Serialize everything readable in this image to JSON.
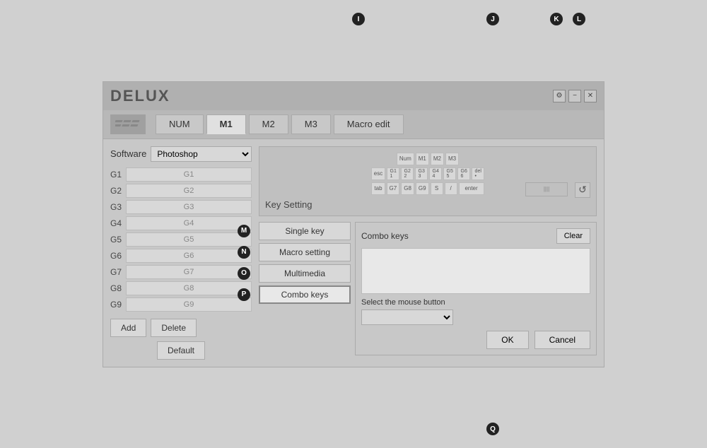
{
  "app": {
    "title": "DELUX",
    "window_controls": {
      "settings_label": "⚙",
      "minimize_label": "−",
      "close_label": "✕"
    }
  },
  "nav": {
    "icon_label": "///",
    "tabs": [
      {
        "id": "num",
        "label": "NUM",
        "active": false
      },
      {
        "id": "m1",
        "label": "M1",
        "active": true
      },
      {
        "id": "m2",
        "label": "M2",
        "active": false
      },
      {
        "id": "m3",
        "label": "M3",
        "active": false
      },
      {
        "id": "macro_edit",
        "label": "Macro edit",
        "active": false
      }
    ]
  },
  "left_panel": {
    "software_label": "Software",
    "software_value": "Photoshop",
    "g_keys": [
      {
        "label": "G1",
        "value": "G1"
      },
      {
        "label": "G2",
        "value": "G2"
      },
      {
        "label": "G3",
        "value": "G3"
      },
      {
        "label": "G4",
        "value": "G4"
      },
      {
        "label": "G5",
        "value": "G5"
      },
      {
        "label": "G6",
        "value": "G6"
      },
      {
        "label": "G7",
        "value": "G7"
      },
      {
        "label": "G8",
        "value": "G8"
      },
      {
        "label": "G9",
        "value": "G9"
      }
    ],
    "add_label": "Add",
    "delete_label": "Delete",
    "default_label": "Default"
  },
  "key_setting": {
    "label": "Key Setting",
    "reset_icon": "↺"
  },
  "options": {
    "single_key_label": "Single key",
    "macro_setting_label": "Macro setting",
    "multimedia_label": "Multimedia",
    "combo_keys_label": "Combo keys"
  },
  "combo_panel": {
    "title": "Combo keys",
    "clear_label": "Clear",
    "mouse_btn_label": "Select the mouse button"
  },
  "footer": {
    "ok_label": "OK",
    "cancel_label": "Cancel"
  },
  "annotations": {
    "I": "M1 tab annotation",
    "J": "Combo keys text area annotation",
    "K": "Settings button annotation",
    "L": "Close button annotation",
    "M": "Single key annotation",
    "N": "Macro setting annotation",
    "O": "Delete button annotation",
    "P": "Combo keys button annotation",
    "Q": "Cancel button annotation"
  },
  "keyboard_mini": {
    "row1": [
      "Num",
      "M1",
      "M2",
      "M3"
    ],
    "row2_left": [
      "esc"
    ],
    "row2_keys": [
      "G1 1",
      "G2 2",
      "G3 3",
      "G4 4",
      "G5 5",
      "G6 6",
      "delete •"
    ],
    "row3_keys": [
      "tab",
      "G7",
      "G8",
      "G9",
      "S",
      "/",
      "enter"
    ]
  }
}
